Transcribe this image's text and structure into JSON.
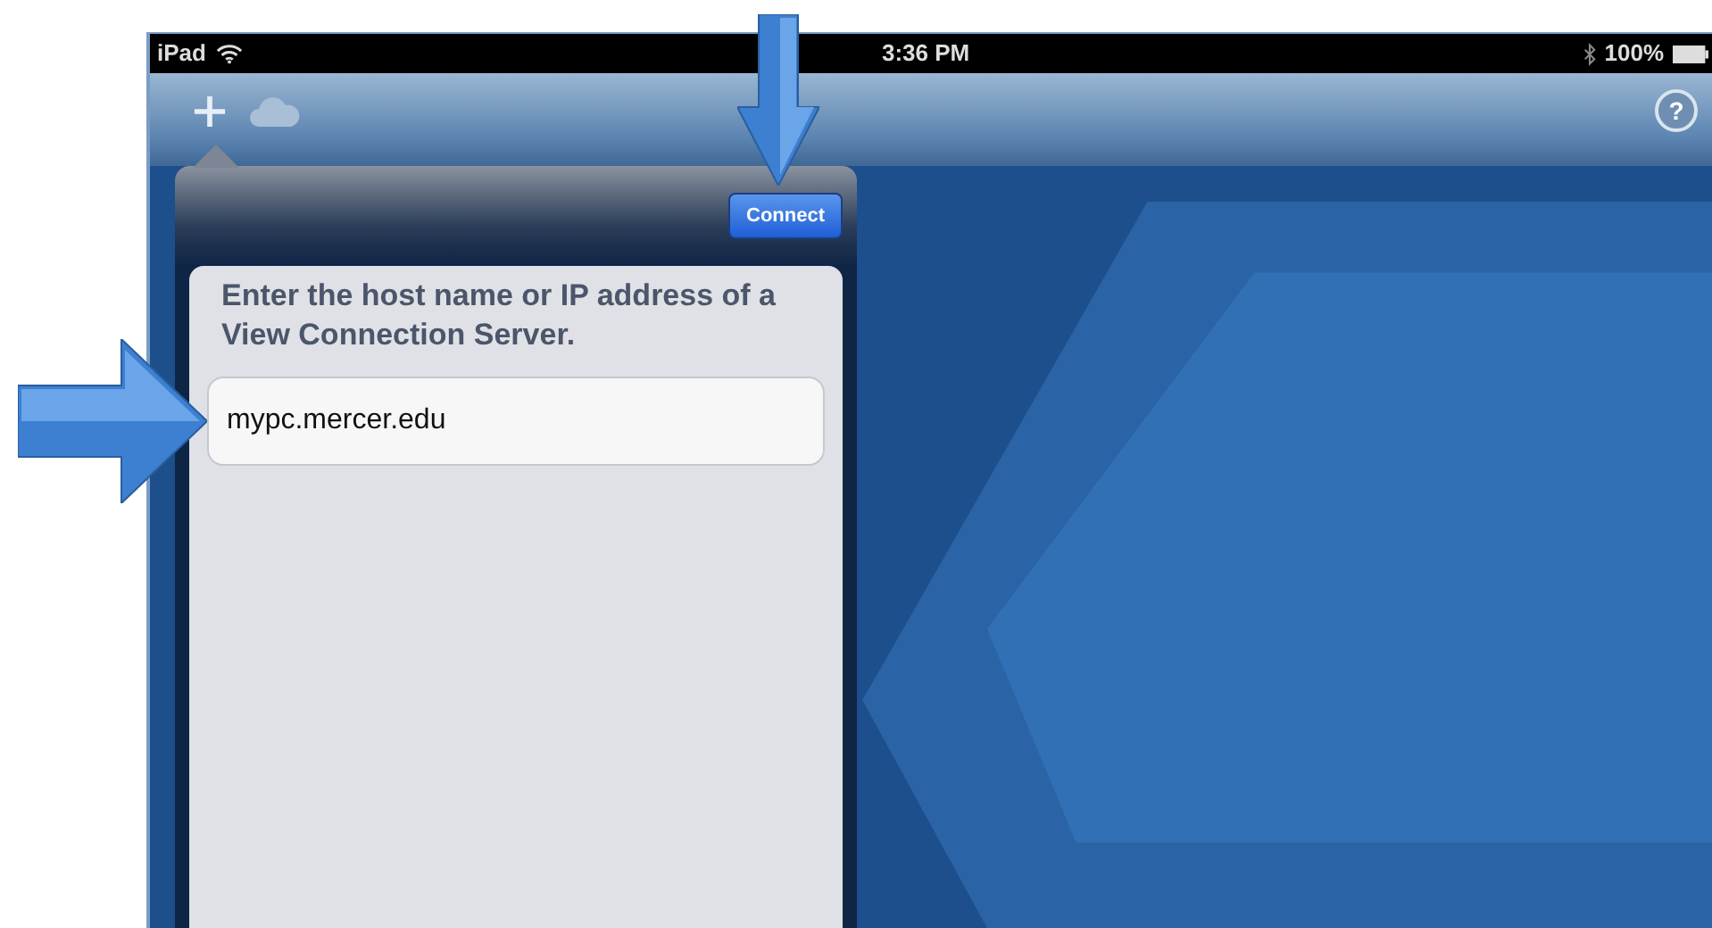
{
  "status_bar": {
    "carrier": "iPad",
    "time": "3:36 PM",
    "battery": "100%"
  },
  "toolbar": {
    "help_button": "?"
  },
  "popover": {
    "button": "Connect",
    "prompt": "Enter the host name or IP address of a View Connection Server.",
    "server_field": {
      "value": "mypc.mercer.edu"
    }
  }
}
